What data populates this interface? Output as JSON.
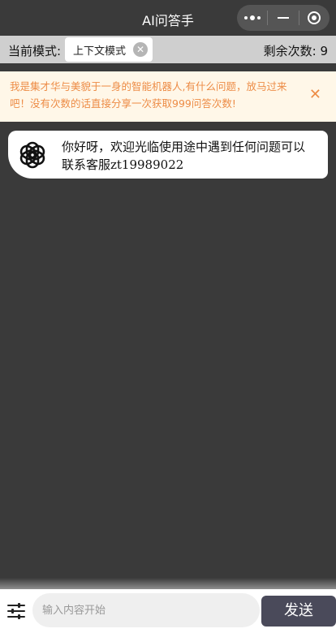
{
  "app": {
    "title": "AI问答手"
  },
  "mode": {
    "label": "当前模式:",
    "current": "上下文模式",
    "remaining_label": "剩余次数:",
    "remaining_value": "9"
  },
  "notice": {
    "text": "我是集才华与美貌于一身的智能机器人,有什么问题，放马过来吧！没有次数的话直接分享一次获取999问答次数!",
    "close": "✕"
  },
  "messages": [
    {
      "role": "bot",
      "avatar_icon": "openai-logo-icon",
      "text": "你好呀，欢迎光临使用途中遇到任何问题可以联系客服zt19989022"
    }
  ],
  "composer": {
    "placeholder": "输入内容开始",
    "value": "",
    "send_label": "发送",
    "settings_icon": "sliders-icon"
  },
  "colors": {
    "background": "#3a3a3a",
    "notice_bg": "#fff7e8",
    "notice_text": "#ed8c46",
    "send_bg": "#4a4a5a"
  }
}
